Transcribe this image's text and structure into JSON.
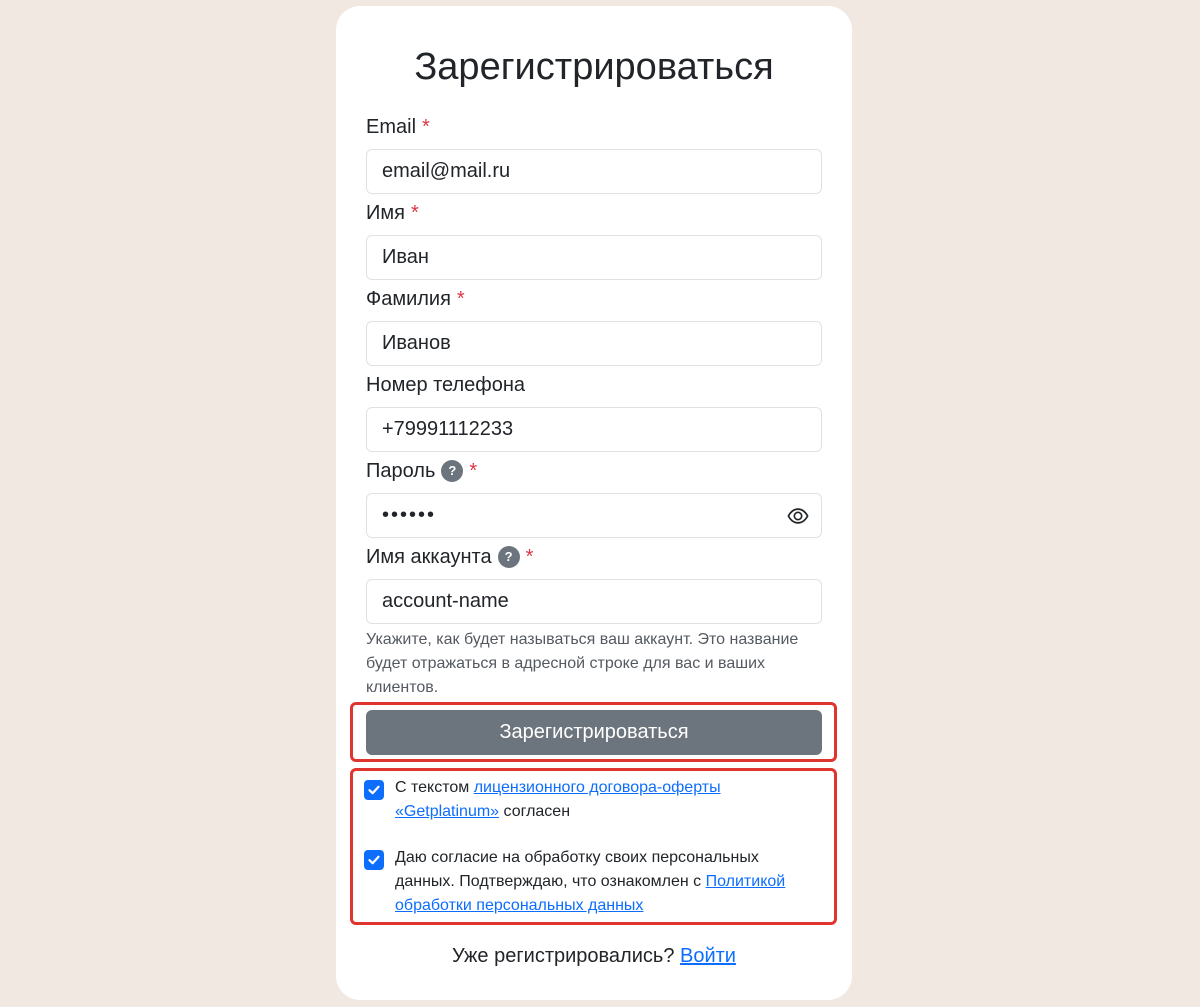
{
  "form": {
    "title": "Зарегистрироваться",
    "required_mark": "*",
    "help_mark": "?",
    "fields": {
      "email": {
        "label": "Email",
        "value": "email@mail.ru"
      },
      "first_name": {
        "label": "Имя",
        "value": "Иван"
      },
      "last_name": {
        "label": "Фамилия",
        "value": "Иванов"
      },
      "phone": {
        "label": "Номер телефона",
        "value": "+79991112233"
      },
      "password": {
        "label": "Пароль",
        "value": "••••••"
      },
      "account_name": {
        "label": "Имя аккаунта",
        "value": "account-name",
        "hint": "Укажите, как будет называться ваш аккаунт. Это название будет отражаться в адресной строке для вас и ваших клиентов."
      }
    },
    "submit_label": "Зарегистрироваться",
    "consents": {
      "license": {
        "checked": true,
        "text_before": "С текстом ",
        "link": "лицензионного договора-оферты «Getplatinum»",
        "text_after": " согласен"
      },
      "personal_data": {
        "checked": true,
        "text_before": "Даю согласие на обработку своих персональных данных. Подтверждаю, что ознакомлен с ",
        "link": "Политикой обработки персональных данных",
        "text_after": ""
      }
    },
    "footer": {
      "text": "Уже регистрировались? ",
      "login_link": "Войти"
    }
  },
  "colors": {
    "page_background": "#f1e8e1",
    "card_background": "#ffffff",
    "required": "#dc3545",
    "button_background": "#6c757d",
    "checkbox": "#0d6efd",
    "link": "#0d6efd",
    "highlight": "#e0342f"
  },
  "icons": {
    "password_toggle": "eye-icon",
    "checkbox_mark": "checkmark-icon",
    "help": "question-icon"
  }
}
